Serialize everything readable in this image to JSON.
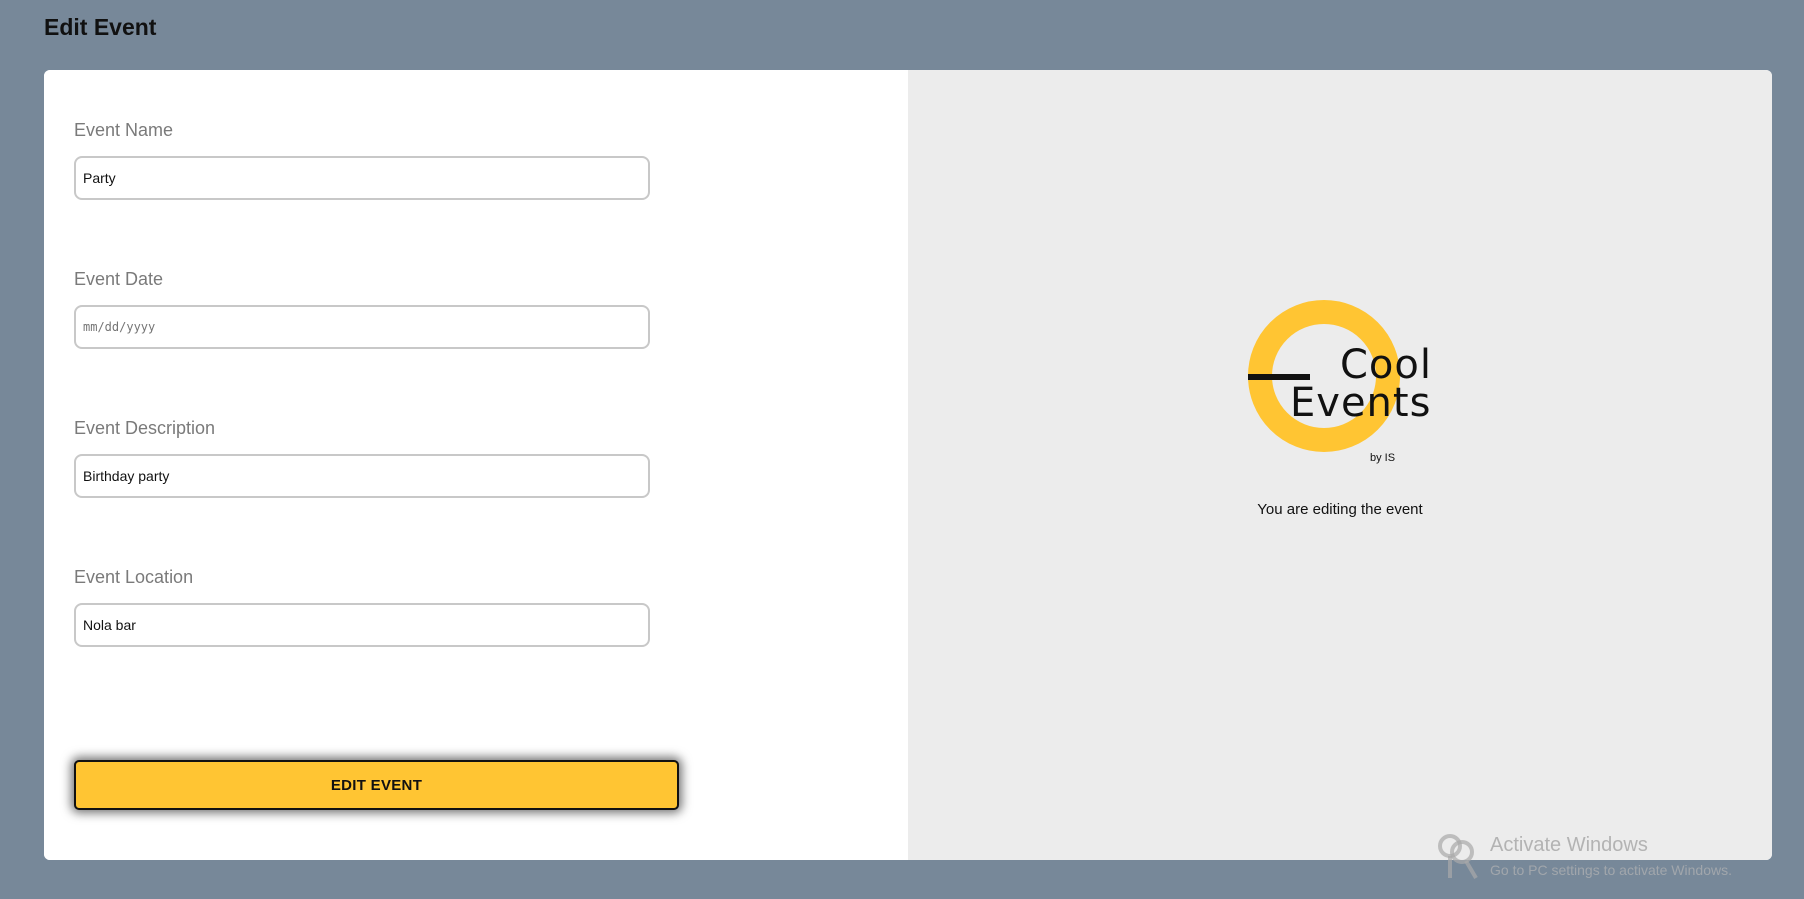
{
  "page": {
    "title": "Edit Event"
  },
  "form": {
    "fields": [
      {
        "label": "Event Name",
        "value": "Party",
        "type": "text"
      },
      {
        "label": "Event Date",
        "value": "",
        "placeholder": "mm/dd/yyyy",
        "type": "date"
      },
      {
        "label": "Event Description",
        "value": "Birthday party",
        "type": "text"
      },
      {
        "label": "Event Location",
        "value": "Nola bar",
        "type": "text"
      }
    ],
    "submit_label": "EDIT EVENT"
  },
  "side": {
    "logo": {
      "line1": "Cool",
      "line2": "Events",
      "byline": "by IS"
    },
    "status": "You are editing the event"
  },
  "watermark": {
    "title": "Activate Windows",
    "subtitle": "Go to PC settings to activate Windows."
  },
  "colors": {
    "background": "#778899",
    "accent": "#ffc533",
    "panel": "#ececec"
  }
}
